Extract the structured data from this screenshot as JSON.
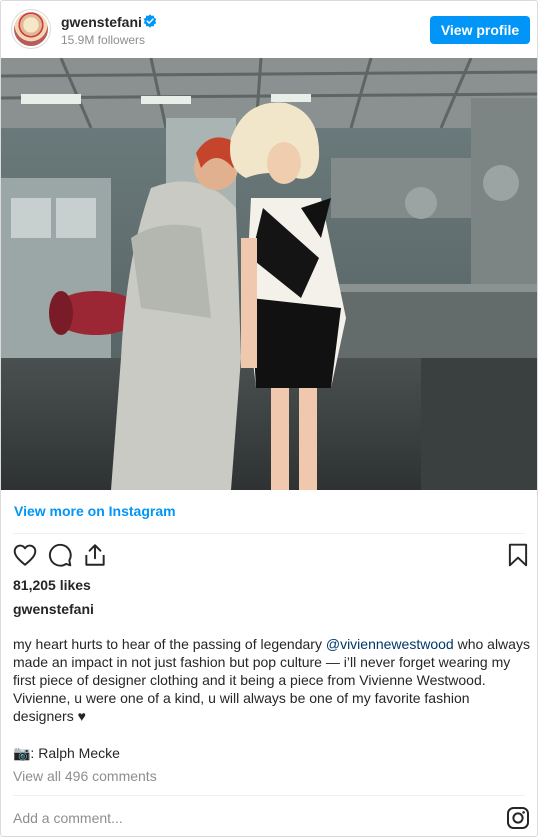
{
  "header": {
    "username": "gwenstefani",
    "followers": "15.9M followers",
    "view_profile_label": "View profile"
  },
  "view_more_label": "View more on Instagram",
  "actions": {
    "like": "heart-icon",
    "comment": "comment-icon",
    "share": "share-icon",
    "save": "bookmark-icon"
  },
  "likes": "81,205 likes",
  "author": "gwenstefani",
  "caption": {
    "before": "my heart hurts to hear of the passing of legendary ",
    "mention": "@viviennewestwood",
    "after": " who always made an impact in not just fashion but pop culture — i’ll never forget wearing my first piece of designer clothing and it being a piece from Vivienne Westwood. Vivienne, u were one of a kind, u will always be one of my favorite fashion designers ♥"
  },
  "photo_credit": "📷: Ralph Mecke",
  "view_comments": "View all 496 comments",
  "add_comment_placeholder": "Add a comment...",
  "colors": {
    "accent": "#0095f6",
    "mention": "#00376b",
    "muted": "#8e8e8e"
  }
}
